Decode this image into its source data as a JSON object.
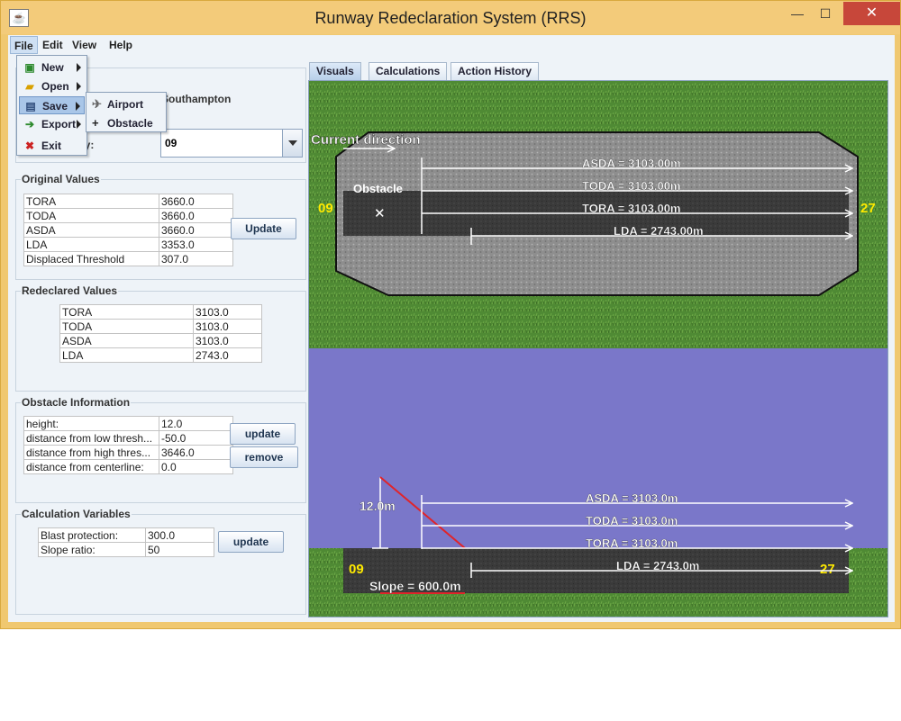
{
  "window": {
    "title": "Runway Redeclaration System (RRS)",
    "icon_name": "java-cup-icon",
    "controls": {
      "minimize": "—",
      "maximize": "☐",
      "close": "✕"
    }
  },
  "menubar": [
    "File",
    "Edit",
    "View",
    "Help"
  ],
  "file_menu": {
    "items": [
      {
        "label": "New",
        "icon": "new-file-icon",
        "has_submenu": true
      },
      {
        "label": "Open",
        "icon": "folder-open-icon",
        "has_submenu": true
      },
      {
        "label": "Save",
        "icon": "floppy-disk-icon",
        "has_submenu": true,
        "highlighted": true
      },
      {
        "label": "Export",
        "icon": "export-icon",
        "has_submenu": true
      },
      {
        "label": "Exit",
        "icon": "exit-icon",
        "has_submenu": false
      }
    ],
    "save_submenu": [
      {
        "label": "Airport",
        "icon": "airplane-icon"
      },
      {
        "label": "Obstacle",
        "icon": "plus-icon"
      }
    ]
  },
  "airport": {
    "name": "Southampton"
  },
  "runway": {
    "label": "ay:",
    "selected": "09"
  },
  "original_values": {
    "title": "Original Values",
    "rows": [
      [
        "TORA",
        "3660.0"
      ],
      [
        "TODA",
        "3660.0"
      ],
      [
        "ASDA",
        "3660.0"
      ],
      [
        "LDA",
        "3353.0"
      ],
      [
        "Displaced Threshold",
        "307.0"
      ]
    ],
    "button": "Update"
  },
  "redeclared_values": {
    "title": "Redeclared Values",
    "rows": [
      [
        "TORA",
        "3103.0"
      ],
      [
        "TODA",
        "3103.0"
      ],
      [
        "ASDA",
        "3103.0"
      ],
      [
        "LDA",
        "2743.0"
      ]
    ]
  },
  "obstacle_info": {
    "title": "Obstacle Information",
    "rows": [
      [
        "height:",
        "12.0"
      ],
      [
        "distance from low thresh...",
        "-50.0"
      ],
      [
        "distance from high thres...",
        "3646.0"
      ],
      [
        "distance from centerline:",
        "0.0"
      ]
    ],
    "update_button": "update",
    "remove_button": "remove"
  },
  "calc_vars": {
    "title": "Calculation Variables",
    "rows": [
      [
        "Blast protection:",
        "300.0"
      ],
      [
        "Slope ratio:",
        "50"
      ]
    ],
    "button": "update"
  },
  "tabs": [
    "Visuals",
    "Calculations",
    "Action History"
  ],
  "active_tab": "Visuals",
  "top_view": {
    "current_direction": "Current direction",
    "obstacle_label": "Obstacle",
    "obstacle_marker": "✕",
    "left_designator": "09",
    "right_designator": "27",
    "distances": [
      "ASDA = 3103.00m",
      "TODA = 3103.00m",
      "TORA = 3103.00m",
      "LDA = 2743.00m"
    ]
  },
  "side_view": {
    "height_label": "12.0m",
    "slope_label": "Slope = 600.0m",
    "left_designator": "09",
    "right_designator": "27",
    "distances": [
      "ASDA = 3103.0m",
      "TODA = 3103.0m",
      "TORA = 3103.0m",
      "LDA = 2743.0m"
    ]
  },
  "colors": {
    "window_frame": "#f0c870",
    "close_button": "#c7473a",
    "grass": "#4f8a34",
    "sky": "#7a77c9",
    "runway_dark": "#3a3a3a",
    "designator": "#ffea00",
    "slope_line": "#e0242a"
  }
}
